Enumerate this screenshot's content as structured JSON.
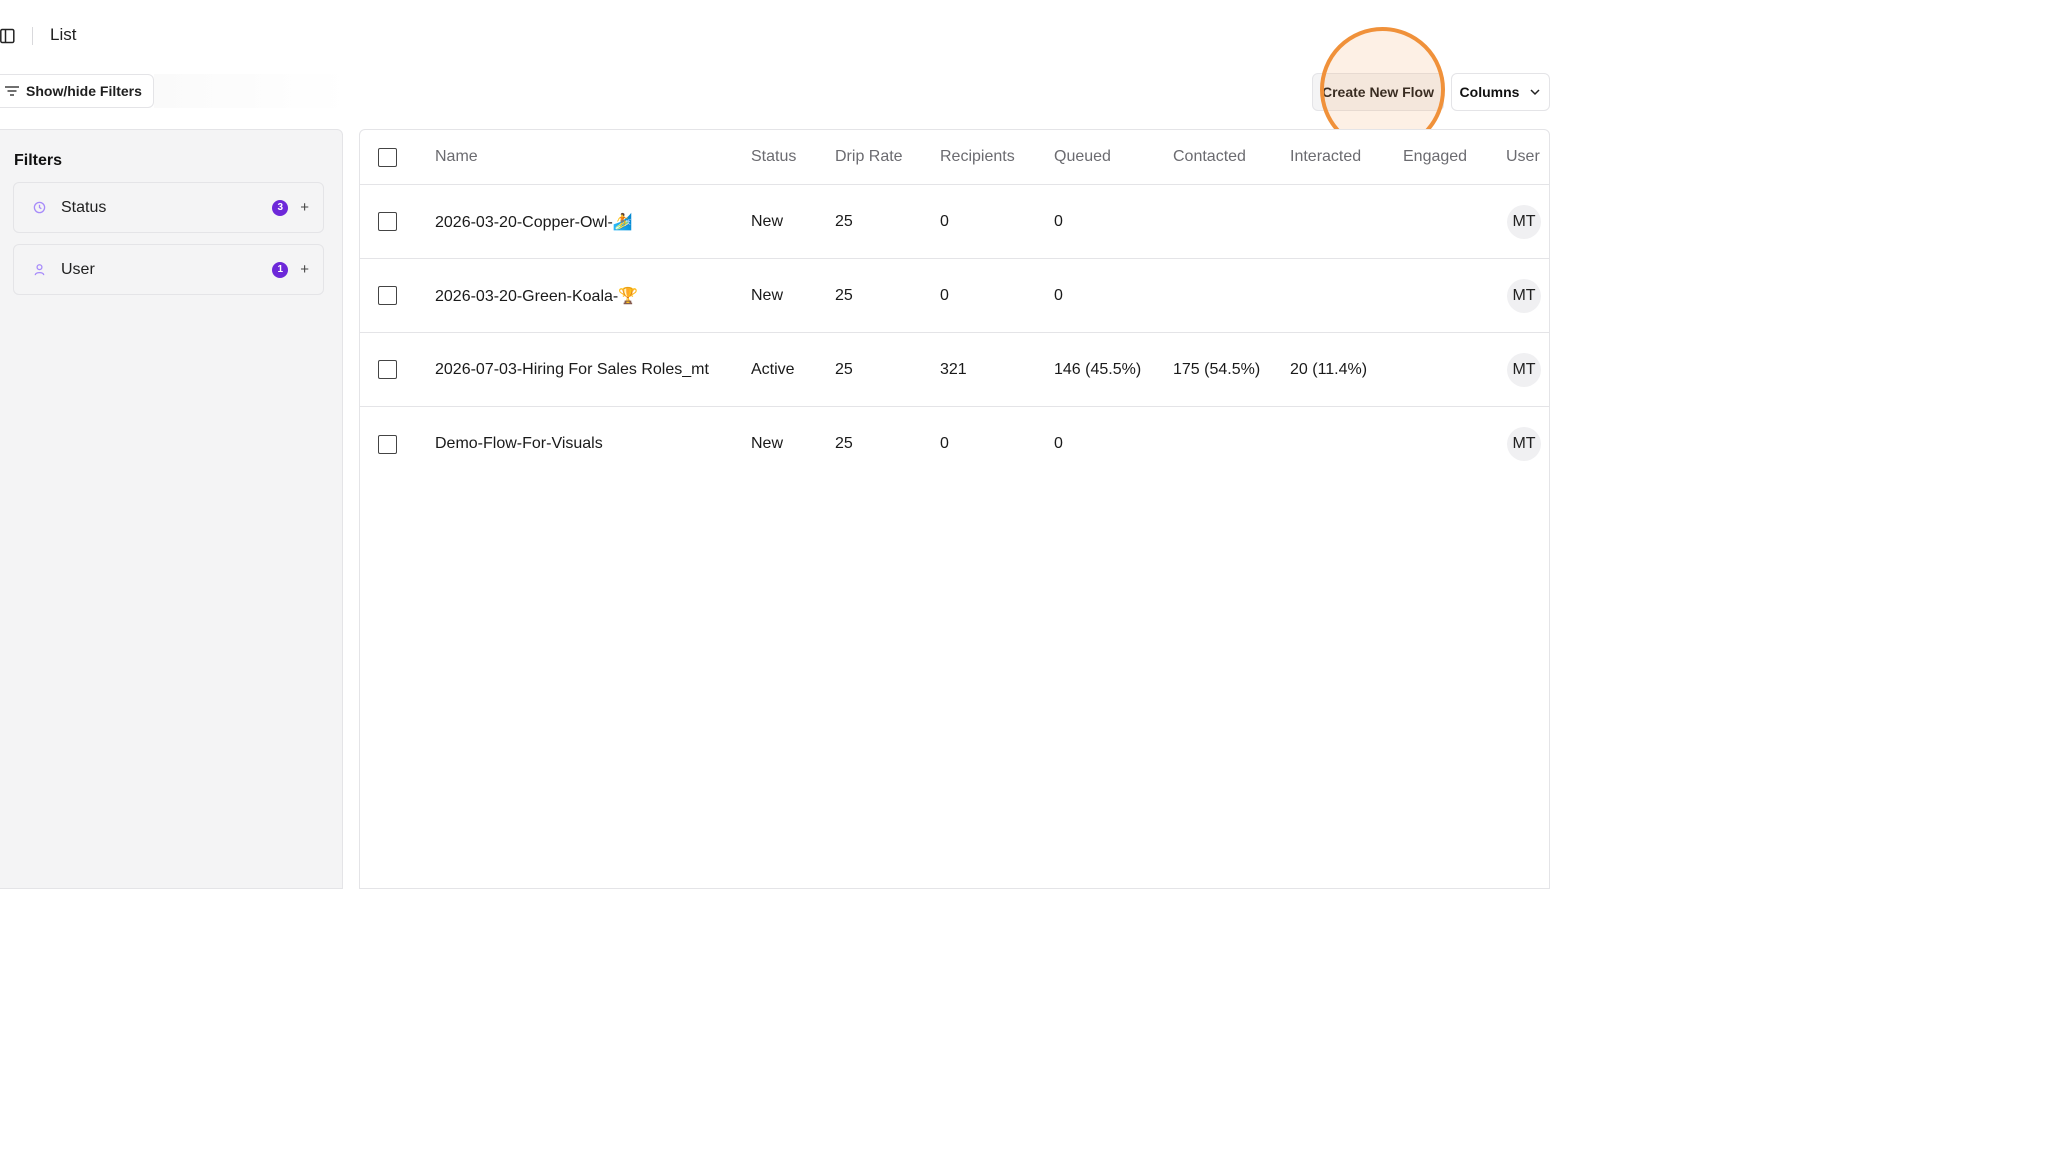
{
  "header": {
    "breadcrumb": "List"
  },
  "toolbar": {
    "filters_label": "Show/hide Filters",
    "create_label": "Create New Flow",
    "columns_label": "Columns"
  },
  "filters": {
    "title": "Filters",
    "items": [
      {
        "label": "Status",
        "count": "3",
        "icon": "clock-icon"
      },
      {
        "label": "User",
        "count": "1",
        "icon": "user-icon"
      }
    ]
  },
  "table": {
    "headers": {
      "name": "Name",
      "status": "Status",
      "drip": "Drip Rate",
      "recipients": "Recipients",
      "queued": "Queued",
      "contacted": "Contacted",
      "interacted": "Interacted",
      "engaged": "Engaged",
      "user": "User"
    },
    "rows": [
      {
        "name": "2026-03-20-Copper-Owl-🏄",
        "status": "New",
        "drip": "25",
        "recipients": "0",
        "queued": "0",
        "contacted": "",
        "interacted": "",
        "engaged": "",
        "user": "MT"
      },
      {
        "name": "2026-03-20-Green-Koala-🏆",
        "status": "New",
        "drip": "25",
        "recipients": "0",
        "queued": "0",
        "contacted": "",
        "interacted": "",
        "engaged": "",
        "user": "MT"
      },
      {
        "name": "2026-07-03-Hiring For Sales Roles_mt",
        "status": "Active",
        "drip": "25",
        "recipients": "321",
        "queued": "146 (45.5%)",
        "contacted": "175 (54.5%)",
        "interacted": "20 (11.4%)",
        "engaged": "",
        "user": "MT"
      },
      {
        "name": "Demo-Flow-For-Visuals",
        "status": "New",
        "drip": "25",
        "recipients": "0",
        "queued": "0",
        "contacted": "",
        "interacted": "",
        "engaged": "",
        "user": "MT"
      }
    ]
  },
  "colors": {
    "accent": "#6d28d9",
    "highlight": "#f0913a"
  }
}
